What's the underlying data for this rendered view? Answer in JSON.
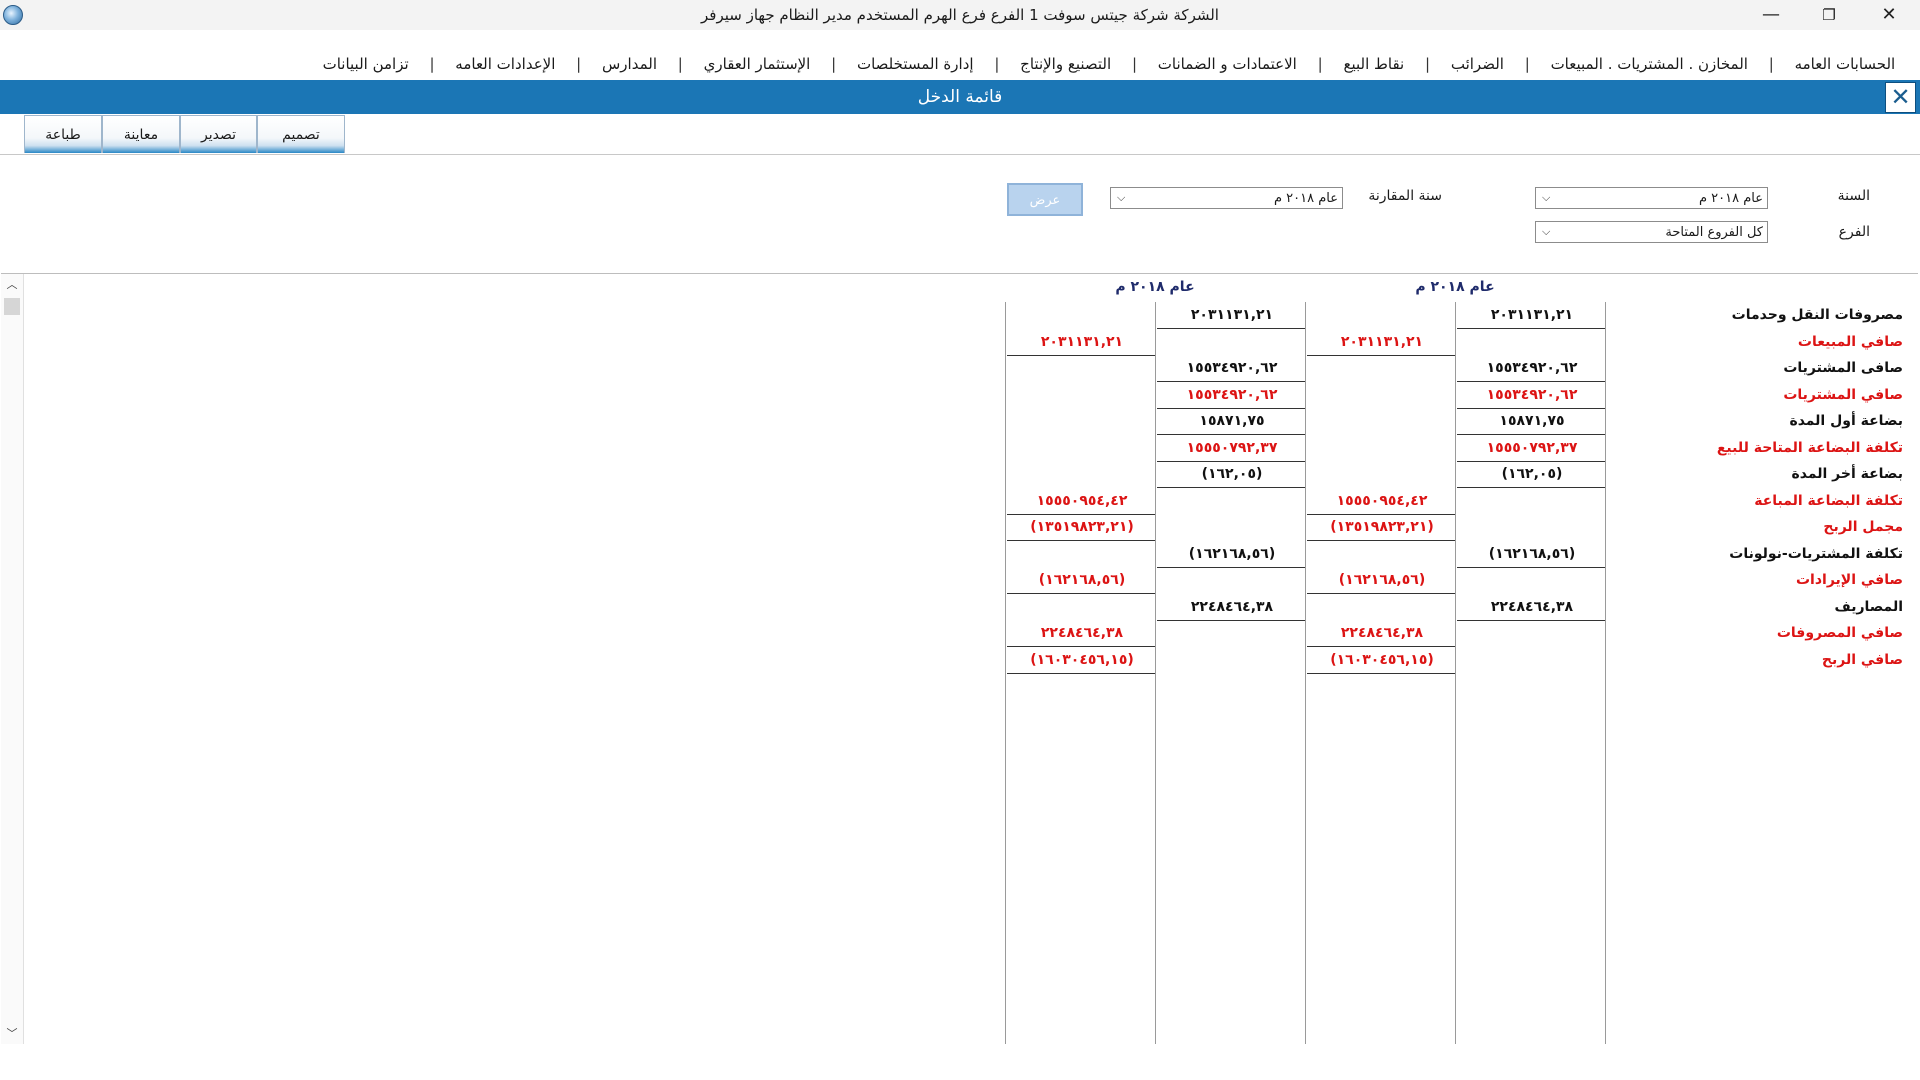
{
  "window": {
    "title": "الشركة شركة جيتس سوفت 1   الفرع فرع الهرم   المستخدم مدير النظام   جهاز سيرفر",
    "minimize": "—",
    "maximize": "❐",
    "close": "✕"
  },
  "menu": [
    "الحسابات العامه",
    "المخازن . المشتريات . المبيعات",
    "الضرائب",
    "نقاط البيع",
    "الاعتمادات و الضمانات",
    "التصنيع والإنتاج",
    "إدارة المستخلصات",
    "الإستثمار العقاري",
    "المدارس",
    "الإعدادات العامه",
    "تزامن البيانات"
  ],
  "form": {
    "title": "قائمة الدخل",
    "close": "✕"
  },
  "toolbar": {
    "design": "تصميم",
    "export": "تصدير",
    "preview": "معاينة",
    "print": "طباعة"
  },
  "filters": {
    "year_label": "السنة",
    "year_value": "عام ٢٠١٨ م",
    "compare_label": "سنة المقارنة",
    "compare_value": "عام ٢٠١٨ م",
    "branch_label": "الفرع",
    "branch_value": "كل الفروع المتاحة",
    "show_button": "عرض"
  },
  "report": {
    "col_header_1": "عام ٢٠١٨ م",
    "col_header_2": "عام ٢٠١٨ م",
    "rows": [
      {
        "label": "مصروفات النقل وحدمات",
        "red": false,
        "a": "٢٠٣١١٣١,٢١",
        "b": "",
        "c": "٢٠٣١١٣١,٢١",
        "d": ""
      },
      {
        "label": "صافي المبيعات",
        "red": true,
        "a": "",
        "b": "٢٠٣١١٣١,٢١",
        "c": "",
        "d": "٢٠٣١١٣١,٢١"
      },
      {
        "label": "صافى المشتريات",
        "red": false,
        "a": "١٥٥٣٤٩٢٠,٦٢",
        "b": "",
        "c": "١٥٥٣٤٩٢٠,٦٢",
        "d": ""
      },
      {
        "label": "صافي المشتريات",
        "red": true,
        "a": "١٥٥٣٤٩٢٠,٦٢",
        "b": "",
        "c": "١٥٥٣٤٩٢٠,٦٢",
        "d": ""
      },
      {
        "label": "بضاعة أول المدة",
        "red": false,
        "a": "١٥٨٧١,٧٥",
        "b": "",
        "c": "١٥٨٧١,٧٥",
        "d": ""
      },
      {
        "label": "تكلفة البضاعة المتاحة للبيع",
        "red": true,
        "a": "١٥٥٥٠٧٩٢,٣٧",
        "b": "",
        "c": "١٥٥٥٠٧٩٢,٣٧",
        "d": ""
      },
      {
        "label": "بضاعة أخر المدة",
        "red": false,
        "a": "(١٦٢,٠٥)",
        "b": "",
        "c": "(١٦٢,٠٥)",
        "d": ""
      },
      {
        "label": "تكلفة البضاعة المباعة",
        "red": true,
        "a": "",
        "b": "١٥٥٥٠٩٥٤,٤٢",
        "c": "",
        "d": "١٥٥٥٠٩٥٤,٤٢"
      },
      {
        "label": "مجمل الربح",
        "red": true,
        "a": "",
        "b": "(١٣٥١٩٨٢٣,٢١)",
        "c": "",
        "d": "(١٣٥١٩٨٢٣,٢١)"
      },
      {
        "label": "تكلفة المشتريات-نولونات",
        "red": false,
        "a": "(١٦٢١٦٨,٥٦)",
        "b": "",
        "c": "(١٦٢١٦٨,٥٦)",
        "d": ""
      },
      {
        "label": "صافي الإيرادات",
        "red": true,
        "a": "",
        "b": "(١٦٢١٦٨,٥٦)",
        "c": "",
        "d": "(١٦٢١٦٨,٥٦)"
      },
      {
        "label": "المصاريف",
        "red": false,
        "a": "٢٢٤٨٤٦٤,٣٨",
        "b": "",
        "c": "٢٢٤٨٤٦٤,٣٨",
        "d": ""
      },
      {
        "label": "صافي المصروفات",
        "red": true,
        "a": "",
        "b": "٢٢٤٨٤٦٤,٣٨",
        "c": "",
        "d": "٢٢٤٨٤٦٤,٣٨"
      },
      {
        "label": "صافي الربح",
        "red": true,
        "a": "",
        "b": "(١٦٠٣٠٤٥٦,١٥)",
        "c": "",
        "d": "(١٦٠٣٠٤٥٦,١٥)"
      }
    ]
  },
  "icons": {
    "scroll_up": "chevron-up-icon",
    "scroll_down": "chevron-down-icon",
    "combo": "chevron-down-icon"
  }
}
